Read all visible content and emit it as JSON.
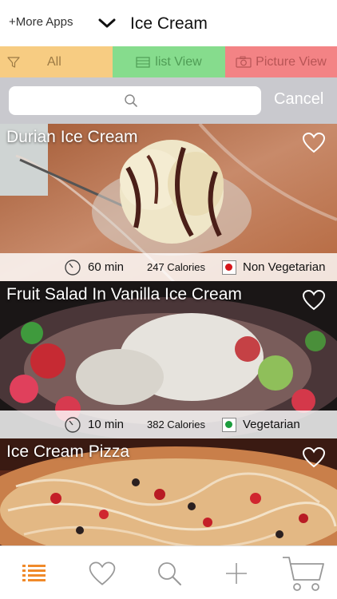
{
  "header": {
    "more_apps": "+More Apps",
    "title": "Ice Cream"
  },
  "filters": {
    "all": "All",
    "list_view": "list View",
    "picture_view": "Picture View"
  },
  "search": {
    "placeholder": "",
    "cancel": "Cancel"
  },
  "recipes": [
    {
      "title": "Durian Ice Cream",
      "time": "60 min",
      "calories": "247 Calories",
      "diet": "Non Vegetarian",
      "diet_color": "#d6161b"
    },
    {
      "title": "Fruit Salad In Vanilla Ice Cream",
      "time": "10 min",
      "calories": "382 Calories",
      "diet": "Vegetarian",
      "diet_color": "#1c9d3d"
    },
    {
      "title": "Ice Cream Pizza"
    }
  ],
  "tabbar": {
    "items": [
      "list-icon",
      "heart-icon",
      "search-icon",
      "plus-icon",
      "cart-icon"
    ],
    "accent": "#f08a2a"
  }
}
